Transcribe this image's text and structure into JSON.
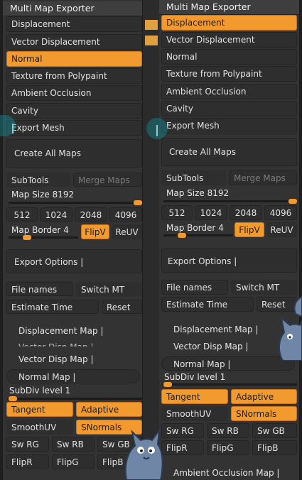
{
  "left": {
    "title": "Multi Map Exporter",
    "maps": [
      "Displacement",
      "Vector Displacement",
      "Normal",
      "Texture from Polypaint",
      "Ambient Occlusion",
      "Cavity",
      "Export Mesh"
    ],
    "create_all": "Create All Maps",
    "subtools": "SubTools",
    "merge_maps": "Merge Maps",
    "map_size_label": "Map Size",
    "map_size_value": "8192",
    "sizes": [
      "512",
      "1024",
      "2048",
      "4096"
    ],
    "map_border_label": "Map Border",
    "map_border_value": "4",
    "flipv": "FlipV",
    "reuv": "ReUV",
    "export_options": "Export Options |",
    "file_names": "File names",
    "switch_mt": "Switch MT",
    "estimate_time": "Estimate Time",
    "reset": "Reset",
    "displacement_map": "Displacement Map |",
    "vector_disp_map_partial": "Vector Disp Map |",
    "vector_disp_map": "Vector Disp Map |",
    "normal_map": "Normal Map |",
    "subdiv_level": "SubDiv level 1",
    "tangent": "Tangent",
    "adaptive": "Adaptive",
    "smoothuv": "SmoothUV",
    "snormals": "SNormals",
    "swaps": [
      "Sw RG",
      "Sw RB",
      "Sw GB"
    ],
    "flips": [
      "FlipR",
      "FlipG",
      "FlipB"
    ]
  },
  "right": {
    "title": "Multi Map Exporter",
    "maps": [
      "Displacement",
      "Vector Displacement",
      "Normal",
      "Texture from Polypaint",
      "Ambient Occlusion",
      "Cavity",
      "Export Mesh"
    ],
    "create_all": "Create All Maps",
    "subtools": "SubTools",
    "merge_maps": "Merge Maps",
    "map_size_label": "Map Size",
    "map_size_value": "8192",
    "sizes": [
      "512",
      "1024",
      "2048",
      "4096"
    ],
    "map_border_label": "Map Border",
    "map_border_value": "4",
    "flipv": "FlipV",
    "reuv": "ReUV",
    "export_options": "Export Options |",
    "file_names": "File names",
    "switch_mt": "Switch MT",
    "estimate_time": "Estimate Time",
    "reset": "Reset",
    "displacement_map": "Displacement Map |",
    "vector_disp_map": "Vector Disp Map |",
    "normal_map": "Normal Map |",
    "subdiv_level": "SubDiv level 1",
    "tangent": "Tangent",
    "adaptive": "Adaptive",
    "smoothuv": "SmoothUV",
    "snormals": "SNormals",
    "swaps": [
      "Sw RG",
      "Sw RB",
      "Sw GB"
    ],
    "flips": [
      "FlipR",
      "FlipG",
      "FlipB"
    ],
    "ao_map": "Ambient Occlusion Map |"
  },
  "state": {
    "left_selected_map": "Normal",
    "right_selected_map": "Displacement",
    "flipv_on": true,
    "tangent_on": true,
    "adaptive_on": true,
    "snormals_on": true,
    "map_size_fraction": 0.95,
    "map_border_fraction": 0.2
  },
  "colors": {
    "accent": "#f29a2e",
    "panel": "#333333",
    "button": "#2e2e2e",
    "text": "#e6e6e6"
  }
}
